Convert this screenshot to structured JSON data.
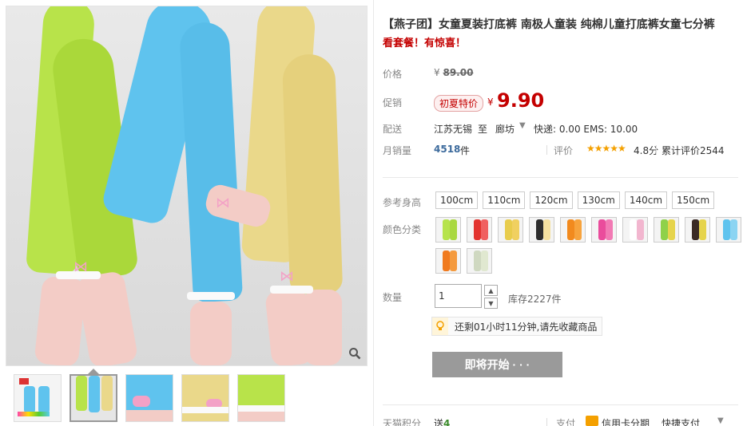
{
  "product": {
    "title": "【燕子团】女童夏装打底裤 南极人童装 纯棉儿童打底裤女童七分裤",
    "subtitle": "看套餐！有惊喜！"
  },
  "price": {
    "label": "价格",
    "currency": "¥",
    "original": "89.00"
  },
  "promo": {
    "label": "促销",
    "badge": "初夏特价",
    "currency": "¥",
    "price": "9.90"
  },
  "shipping": {
    "label": "配送",
    "from": "江苏无锡",
    "to_word": "至",
    "destination": "廊坊",
    "fee": "快递: 0.00 EMS: 10.00"
  },
  "sales": {
    "label": "月销量",
    "count": "4518",
    "unit": "件",
    "rating_label": "评价",
    "stars": "★★★★★",
    "score": "4.8分",
    "reviews": "累计评价2544"
  },
  "height": {
    "label": "参考身高",
    "options": [
      "100cm",
      "110cm",
      "120cm",
      "130cm",
      "140cm",
      "150cm"
    ]
  },
  "color": {
    "label": "颜色分类",
    "swatches": [
      {
        "c1": "#b6e34c",
        "c2": "#a9d840"
      },
      {
        "c1": "#e3342f",
        "c2": "#f06060"
      },
      {
        "c1": "#e8cc4c",
        "c2": "#f0d060"
      },
      {
        "c1": "#2d2d2d",
        "c2": "#f4e0a0"
      },
      {
        "c1": "#f28a1e",
        "c2": "#f7a33d"
      },
      {
        "c1": "#ea4c9c",
        "c2": "#f27ab4"
      },
      {
        "c1": "#ffffff",
        "c2": "#f2b6cf"
      },
      {
        "c1": "#8fd14a",
        "c2": "#e6d44c"
      },
      {
        "c1": "#3a2a24",
        "c2": "#e6d44c"
      },
      {
        "c1": "#5fc3ee",
        "c2": "#8cd4f2"
      },
      {
        "c1": "#f07a1e",
        "c2": "#f49a3e"
      },
      {
        "c1": "#cfd8c0",
        "c2": "#e0e8d0"
      }
    ]
  },
  "quantity": {
    "label": "数量",
    "value": "1",
    "stock": "库存2227件"
  },
  "tip": {
    "text": "还剩01小时11分钟,请先收藏商品"
  },
  "buy_button": {
    "label": "即将开始 · · ·"
  },
  "footer": {
    "points_label": "天猫积分",
    "points_prefix": "送",
    "points_value": "4",
    "pay_label": "支付",
    "card_text": "信用卡分期",
    "quick_pay": "快捷支付"
  },
  "colors": {
    "accent_red": "#c40000",
    "link_blue": "#3c6a9c",
    "star_orange": "#f4a000",
    "button_grey": "#9a9a9a"
  }
}
